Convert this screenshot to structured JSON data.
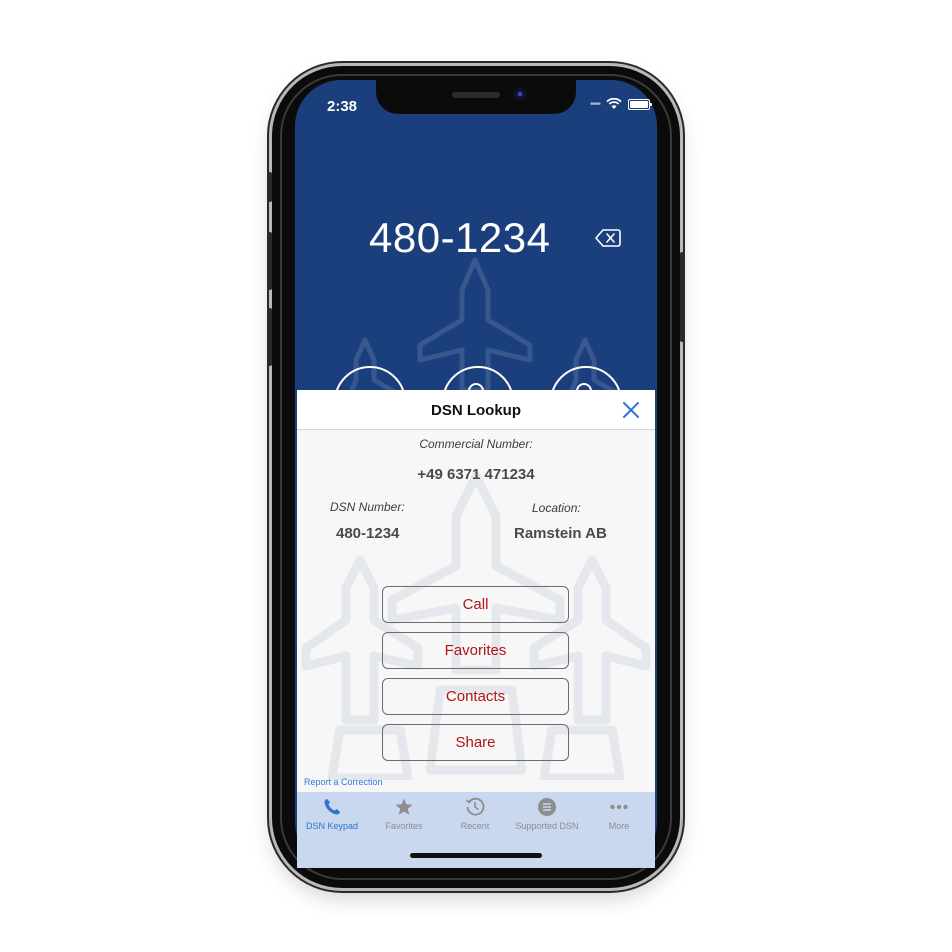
{
  "status_bar": {
    "time": "2:38"
  },
  "keypad": {
    "dialed_number": "480-1234"
  },
  "modal": {
    "title": "DSN Lookup",
    "commercial_label": "Commercial Number:",
    "commercial_value": "+49 6371 471234",
    "dsn_label": "DSN Number:",
    "dsn_value": "480-1234",
    "location_label": "Location:",
    "location_value": "Ramstein AB",
    "buttons": {
      "call": "Call",
      "favorites": "Favorites",
      "contacts": "Contacts",
      "share": "Share"
    },
    "report_link": "Report a Correction"
  },
  "tabs": [
    {
      "label": "DSN Keypad",
      "icon": "phone-icon",
      "active": true
    },
    {
      "label": "Favorites",
      "icon": "star-icon",
      "active": false
    },
    {
      "label": "Recent",
      "icon": "clock-icon",
      "active": false
    },
    {
      "label": "Supported DSN",
      "icon": "list-icon",
      "active": false
    },
    {
      "label": "More",
      "icon": "ellipsis-icon",
      "active": false
    }
  ],
  "colors": {
    "header_blue": "#1b3f7d",
    "tabbar_bg": "#c9d7ef",
    "action_text": "#b01414",
    "active_tab": "#2d74d0",
    "close_icon": "#2d74d0"
  }
}
